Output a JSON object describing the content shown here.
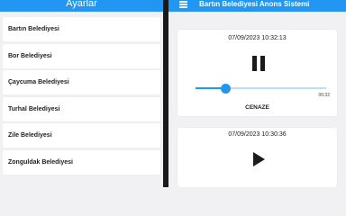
{
  "settings_screen": {
    "title": "Ayarlar",
    "items": [
      {
        "label": "Bartın Belediyesi"
      },
      {
        "label": "Bor Belediyesi"
      },
      {
        "label": "Çaycuma Belediyesi"
      },
      {
        "label": "Turhal Belediyesi"
      },
      {
        "label": "Zile Belediyesi"
      },
      {
        "label": "Zonguldak Belediyesi"
      }
    ]
  },
  "announcement_screen": {
    "title": "Bartın Belediyesi Anons Sistemi",
    "menu_icon": "menu-icon",
    "cards": [
      {
        "timestamp": "07/09/2023 10:32:13",
        "state": "playing",
        "control_icon": "pause-icon",
        "progress_fraction": 0.23,
        "duration": "00:32",
        "label": "CENAZE"
      },
      {
        "timestamp": "07/09/2023 10:30:36",
        "state": "paused",
        "control_icon": "play-icon"
      }
    ]
  },
  "colors": {
    "primary": "#2196f3",
    "slider_inactive": "#bbdefb",
    "background": "#f1f1f3",
    "divider": "#1a1a1a"
  }
}
